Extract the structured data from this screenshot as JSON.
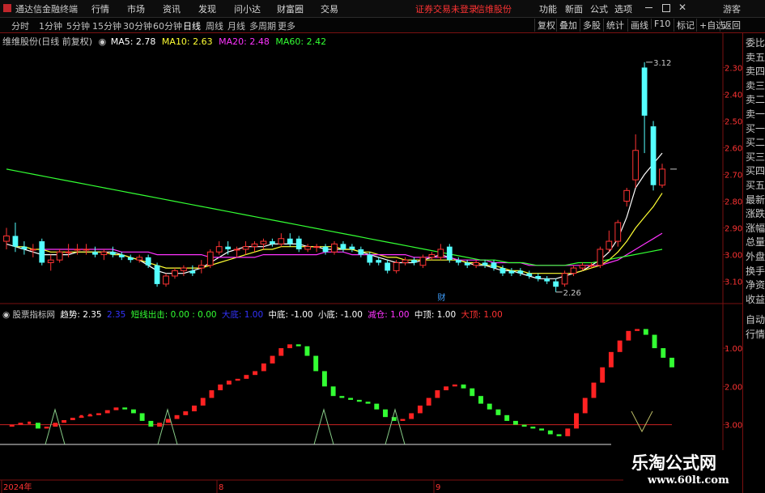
{
  "menubar": {
    "app_title": "通达信金融终端",
    "menus": [
      "行情",
      "市场",
      "资讯",
      "发现",
      "问小达",
      "财富圈",
      "交易"
    ],
    "login_notice": "证券交易未登录",
    "broker": "信维股份",
    "right_items": [
      "功能",
      "新面",
      "公式",
      "选项"
    ],
    "window_controls": [
      "minimize",
      "restore",
      "close"
    ],
    "extra": "游客"
  },
  "period_bar": {
    "periods": [
      "分时",
      "1分钟",
      "5分钟",
      "15分钟",
      "30分钟",
      "60分钟",
      "日线",
      "周线",
      "月线",
      "多周期",
      "更多"
    ],
    "active_period": "日线",
    "tools": [
      "复权",
      "叠加",
      "多股",
      "统计",
      "画线",
      "F10",
      "标记",
      "+自选",
      "返回"
    ]
  },
  "main_chart": {
    "stock_label": "维维股份(日线 前复权)",
    "ma_items": [
      {
        "label": "MA5: 2.78",
        "color": "#ffffff"
      },
      {
        "label": "MA10: 2.63",
        "color": "#ffff33"
      },
      {
        "label": "MA20: 2.48",
        "color": "#ff33ff"
      },
      {
        "label": "MA60: 2.42",
        "color": "#33ff33"
      }
    ],
    "high_marker": "3.12",
    "low_marker": "2.26",
    "cai_marker": "财",
    "y_ticks": [
      "3.10",
      "3.00",
      "2.90",
      "2.80",
      "2.70",
      "2.60",
      "2.50",
      "2.40",
      "2.30"
    ]
  },
  "indicator": {
    "name": "股票指标网",
    "items": [
      {
        "label": "趋势: 2.35",
        "color": "#ffffff"
      },
      {
        "label": "2.35",
        "color": "#3333ff"
      },
      {
        "label": "短线出击: 0.00 : 0.00",
        "color": "#33ff33"
      },
      {
        "label": "大底: 1.00",
        "color": "#3333ff"
      },
      {
        "label": "中底: -1.00",
        "color": "#ffffff"
      },
      {
        "label": "小底: -1.00",
        "color": "#ffffff"
      },
      {
        "label": "减仓: 1.00",
        "color": "#ff33ff"
      },
      {
        "label": "中顶: 1.00",
        "color": "#ffffff"
      },
      {
        "label": "大顶: 1.00",
        "color": "#ff3333"
      }
    ],
    "y_ticks": [
      "3.00",
      "2.00",
      "1.00"
    ]
  },
  "time_axis": [
    "2024年",
    "8",
    "9"
  ],
  "right_panel": {
    "items": [
      "委比",
      "卖五",
      "卖四",
      "卖三",
      "卖二",
      "卖一",
      "买一",
      "买二",
      "买三",
      "买四",
      "买五",
      "最新",
      "涨跌",
      "涨幅",
      "总量",
      "外盘",
      "换手",
      "净资",
      "收益"
    ],
    "bottom_items": [
      "自动",
      "行情"
    ]
  },
  "watermark": {
    "title": "乐淘公式网",
    "url": "www.60lt.com"
  },
  "colors": {
    "up": "#ff3333",
    "down": "#54ffff",
    "grid_red": "#7a1010",
    "ma5": "#ffffff",
    "ma10": "#ffff33",
    "ma20": "#ff33ff",
    "ma60": "#33ff33"
  },
  "chart_data": [
    {
      "type": "candlestick",
      "title": "维维股份(日线 前复权)",
      "ylim": [
        2.22,
        3.18
      ],
      "y_ticks": [
        2.3,
        2.4,
        2.5,
        2.6,
        2.7,
        2.8,
        2.9,
        3.0,
        3.1
      ],
      "candles": [
        {
          "o": 2.45,
          "h": 2.5,
          "l": 2.42,
          "c": 2.47
        },
        {
          "o": 2.47,
          "h": 2.52,
          "l": 2.41,
          "c": 2.43
        },
        {
          "o": 2.43,
          "h": 2.45,
          "l": 2.4,
          "c": 2.42
        },
        {
          "o": 2.42,
          "h": 2.44,
          "l": 2.39,
          "c": 2.42
        },
        {
          "o": 2.45,
          "h": 2.46,
          "l": 2.36,
          "c": 2.37
        },
        {
          "o": 2.37,
          "h": 2.4,
          "l": 2.34,
          "c": 2.38
        },
        {
          "o": 2.38,
          "h": 2.42,
          "l": 2.37,
          "c": 2.41
        },
        {
          "o": 2.41,
          "h": 2.44,
          "l": 2.39,
          "c": 2.41
        },
        {
          "o": 2.42,
          "h": 2.44,
          "l": 2.4,
          "c": 2.42
        },
        {
          "o": 2.42,
          "h": 2.44,
          "l": 2.4,
          "c": 2.42
        },
        {
          "o": 2.41,
          "h": 2.43,
          "l": 2.39,
          "c": 2.4
        },
        {
          "o": 2.4,
          "h": 2.42,
          "l": 2.38,
          "c": 2.41
        },
        {
          "o": 2.41,
          "h": 2.43,
          "l": 2.39,
          "c": 2.4
        },
        {
          "o": 2.4,
          "h": 2.41,
          "l": 2.38,
          "c": 2.39
        },
        {
          "o": 2.39,
          "h": 2.4,
          "l": 2.37,
          "c": 2.38
        },
        {
          "o": 2.38,
          "h": 2.4,
          "l": 2.37,
          "c": 2.39
        },
        {
          "o": 2.39,
          "h": 2.4,
          "l": 2.35,
          "c": 2.36
        },
        {
          "o": 2.36,
          "h": 2.37,
          "l": 2.28,
          "c": 2.29
        },
        {
          "o": 2.29,
          "h": 2.33,
          "l": 2.28,
          "c": 2.32
        },
        {
          "o": 2.32,
          "h": 2.35,
          "l": 2.31,
          "c": 2.34
        },
        {
          "o": 2.34,
          "h": 2.36,
          "l": 2.32,
          "c": 2.35
        },
        {
          "o": 2.34,
          "h": 2.36,
          "l": 2.32,
          "c": 2.33
        },
        {
          "o": 2.35,
          "h": 2.38,
          "l": 2.33,
          "c": 2.36
        },
        {
          "o": 2.36,
          "h": 2.42,
          "l": 2.35,
          "c": 2.41
        },
        {
          "o": 2.41,
          "h": 2.45,
          "l": 2.4,
          "c": 2.43
        },
        {
          "o": 2.43,
          "h": 2.45,
          "l": 2.4,
          "c": 2.42
        },
        {
          "o": 2.42,
          "h": 2.43,
          "l": 2.39,
          "c": 2.42
        },
        {
          "o": 2.42,
          "h": 2.45,
          "l": 2.4,
          "c": 2.43
        },
        {
          "o": 2.43,
          "h": 2.45,
          "l": 2.41,
          "c": 2.44
        },
        {
          "o": 2.44,
          "h": 2.46,
          "l": 2.42,
          "c": 2.45
        },
        {
          "o": 2.45,
          "h": 2.46,
          "l": 2.43,
          "c": 2.44
        },
        {
          "o": 2.44,
          "h": 2.48,
          "l": 2.43,
          "c": 2.46
        },
        {
          "o": 2.46,
          "h": 2.48,
          "l": 2.43,
          "c": 2.44
        },
        {
          "o": 2.46,
          "h": 2.47,
          "l": 2.41,
          "c": 2.42
        },
        {
          "o": 2.42,
          "h": 2.44,
          "l": 2.41,
          "c": 2.43
        },
        {
          "o": 2.43,
          "h": 2.44,
          "l": 2.41,
          "c": 2.43
        },
        {
          "o": 2.43,
          "h": 2.44,
          "l": 2.4,
          "c": 2.41
        },
        {
          "o": 2.41,
          "h": 2.45,
          "l": 2.4,
          "c": 2.44
        },
        {
          "o": 2.44,
          "h": 2.45,
          "l": 2.41,
          "c": 2.42
        },
        {
          "o": 2.43,
          "h": 2.44,
          "l": 2.41,
          "c": 2.42
        },
        {
          "o": 2.42,
          "h": 2.43,
          "l": 2.39,
          "c": 2.4
        },
        {
          "o": 2.4,
          "h": 2.41,
          "l": 2.36,
          "c": 2.37
        },
        {
          "o": 2.38,
          "h": 2.39,
          "l": 2.36,
          "c": 2.37
        },
        {
          "o": 2.37,
          "h": 2.38,
          "l": 2.33,
          "c": 2.34
        },
        {
          "o": 2.34,
          "h": 2.38,
          "l": 2.33,
          "c": 2.37
        },
        {
          "o": 2.37,
          "h": 2.39,
          "l": 2.36,
          "c": 2.38
        },
        {
          "o": 2.38,
          "h": 2.39,
          "l": 2.36,
          "c": 2.37
        },
        {
          "o": 2.36,
          "h": 2.4,
          "l": 2.35,
          "c": 2.39
        },
        {
          "o": 2.39,
          "h": 2.41,
          "l": 2.38,
          "c": 2.4
        },
        {
          "o": 2.39,
          "h": 2.44,
          "l": 2.38,
          "c": 2.42
        },
        {
          "o": 2.43,
          "h": 2.44,
          "l": 2.37,
          "c": 2.38
        },
        {
          "o": 2.38,
          "h": 2.39,
          "l": 2.36,
          "c": 2.37
        },
        {
          "o": 2.37,
          "h": 2.38,
          "l": 2.35,
          "c": 2.36
        },
        {
          "o": 2.36,
          "h": 2.38,
          "l": 2.35,
          "c": 2.37
        },
        {
          "o": 2.37,
          "h": 2.38,
          "l": 2.35,
          "c": 2.36
        },
        {
          "o": 2.37,
          "h": 2.38,
          "l": 2.34,
          "c": 2.35
        },
        {
          "o": 2.35,
          "h": 2.36,
          "l": 2.32,
          "c": 2.33
        },
        {
          "o": 2.34,
          "h": 2.35,
          "l": 2.32,
          "c": 2.33
        },
        {
          "o": 2.34,
          "h": 2.35,
          "l": 2.32,
          "c": 2.33
        },
        {
          "o": 2.33,
          "h": 2.34,
          "l": 2.31,
          "c": 2.32
        },
        {
          "o": 2.32,
          "h": 2.33,
          "l": 2.3,
          "c": 2.31
        },
        {
          "o": 2.31,
          "h": 2.32,
          "l": 2.29,
          "c": 2.3
        },
        {
          "o": 2.3,
          "h": 2.31,
          "l": 2.26,
          "c": 2.28
        },
        {
          "o": 2.29,
          "h": 2.34,
          "l": 2.28,
          "c": 2.33
        },
        {
          "o": 2.33,
          "h": 2.36,
          "l": 2.32,
          "c": 2.35
        },
        {
          "o": 2.35,
          "h": 2.37,
          "l": 2.34,
          "c": 2.36
        },
        {
          "o": 2.36,
          "h": 2.37,
          "l": 2.35,
          "c": 2.36
        },
        {
          "o": 2.36,
          "h": 2.43,
          "l": 2.35,
          "c": 2.42
        },
        {
          "o": 2.42,
          "h": 2.49,
          "l": 2.41,
          "c": 2.45
        },
        {
          "o": 2.45,
          "h": 2.53,
          "l": 2.43,
          "c": 2.52
        },
        {
          "o": 2.6,
          "h": 2.65,
          "l": 2.58,
          "c": 2.64
        },
        {
          "o": 2.68,
          "h": 2.85,
          "l": 2.65,
          "c": 2.79
        },
        {
          "o": 3.1,
          "h": 3.12,
          "l": 2.78,
          "c": 2.92
        },
        {
          "o": 2.88,
          "h": 2.9,
          "l": 2.64,
          "c": 2.66
        },
        {
          "o": 2.66,
          "h": 2.74,
          "l": 2.65,
          "c": 2.72
        }
      ],
      "ma_series": [
        {
          "name": "MA5",
          "values": [
            2.44,
            2.43,
            2.42,
            2.41,
            2.4,
            2.4,
            2.4,
            2.4,
            2.41,
            2.41,
            2.41,
            2.41,
            2.41,
            2.4,
            2.39,
            2.38,
            2.36,
            2.34,
            2.33,
            2.33,
            2.33,
            2.34,
            2.35,
            2.37,
            2.39,
            2.41,
            2.42,
            2.43,
            2.43,
            2.43,
            2.44,
            2.44,
            2.44,
            2.44,
            2.43,
            2.43,
            2.42,
            2.42,
            2.42,
            2.42,
            2.41,
            2.4,
            2.39,
            2.38,
            2.37,
            2.37,
            2.37,
            2.38,
            2.39,
            2.4,
            2.39,
            2.38,
            2.37,
            2.36,
            2.36,
            2.35,
            2.34,
            2.34,
            2.33,
            2.32,
            2.31,
            2.31,
            2.31,
            2.32,
            2.33,
            2.34,
            2.36,
            2.38,
            2.41,
            2.46,
            2.54,
            2.65,
            2.7,
            2.74,
            2.78
          ]
        },
        {
          "name": "MA10",
          "values": [
            2.43,
            2.43,
            2.42,
            2.42,
            2.41,
            2.41,
            2.41,
            2.41,
            2.41,
            2.41,
            2.41,
            2.4,
            2.4,
            2.39,
            2.38,
            2.37,
            2.36,
            2.35,
            2.35,
            2.35,
            2.35,
            2.35,
            2.36,
            2.37,
            2.38,
            2.39,
            2.4,
            2.41,
            2.42,
            2.42,
            2.43,
            2.43,
            2.43,
            2.43,
            2.43,
            2.43,
            2.43,
            2.42,
            2.42,
            2.41,
            2.41,
            2.4,
            2.39,
            2.39,
            2.38,
            2.38,
            2.38,
            2.38,
            2.38,
            2.38,
            2.38,
            2.37,
            2.37,
            2.36,
            2.36,
            2.35,
            2.34,
            2.34,
            2.33,
            2.33,
            2.33,
            2.33,
            2.33,
            2.33,
            2.34,
            2.35,
            2.36,
            2.38,
            2.41,
            2.45,
            2.5,
            2.54,
            2.58,
            2.63
          ]
        },
        {
          "name": "MA20",
          "values": [
            2.42,
            2.42,
            2.42,
            2.42,
            2.42,
            2.42,
            2.42,
            2.42,
            2.42,
            2.41,
            2.41,
            2.41,
            2.41,
            2.4,
            2.4,
            2.4,
            2.4,
            2.4,
            2.4,
            2.39,
            2.39,
            2.39,
            2.39,
            2.39,
            2.39,
            2.4,
            2.4,
            2.4,
            2.4,
            2.4,
            2.4,
            2.4,
            2.41,
            2.41,
            2.41,
            2.4,
            2.4,
            2.4,
            2.4,
            2.4,
            2.4,
            2.4,
            2.39,
            2.39,
            2.39,
            2.39,
            2.39,
            2.38,
            2.38,
            2.38,
            2.38,
            2.37,
            2.37,
            2.37,
            2.37,
            2.36,
            2.36,
            2.36,
            2.36,
            2.36,
            2.36,
            2.36,
            2.36,
            2.36,
            2.37,
            2.38,
            2.4,
            2.42,
            2.44,
            2.46,
            2.48
          ]
        },
        {
          "name": "MA60",
          "values": [
            2.72,
            2.71,
            2.7,
            2.69,
            2.68,
            2.67,
            2.66,
            2.65,
            2.64,
            2.63,
            2.62,
            2.61,
            2.6,
            2.59,
            2.58,
            2.57,
            2.56,
            2.55,
            2.54,
            2.53,
            2.52,
            2.51,
            2.5,
            2.49,
            2.48,
            2.47,
            2.46,
            2.45,
            2.44,
            2.43,
            2.42,
            2.41,
            2.4,
            2.39,
            2.38,
            2.38,
            2.37,
            2.37,
            2.36,
            2.36,
            2.36,
            2.37,
            2.37,
            2.38,
            2.39,
            2.4,
            2.41,
            2.42
          ]
        }
      ]
    },
    {
      "type": "bar",
      "title": "股票指标网",
      "ylim": [
        0.4,
        3.7
      ],
      "y_ticks": [
        1.0,
        2.0,
        3.0
      ],
      "trend_values": [
        0.95,
        1.0,
        1.05,
        1.05,
        0.9,
        0.95,
        1.05,
        1.12,
        1.18,
        1.22,
        1.25,
        1.3,
        1.38,
        1.45,
        1.4,
        1.3,
        1.1,
        0.95,
        1.05,
        1.15,
        1.25,
        1.35,
        1.5,
        1.7,
        1.9,
        2.05,
        2.15,
        2.2,
        2.3,
        2.4,
        2.6,
        2.8,
        3.0,
        3.1,
        3.05,
        2.8,
        2.4,
        2.0,
        1.75,
        1.7,
        1.65,
        1.6,
        1.55,
        1.4,
        1.2,
        1.1,
        1.15,
        1.3,
        1.5,
        1.7,
        1.9,
        2.0,
        2.05,
        1.95,
        1.75,
        1.55,
        1.4,
        1.25,
        1.1,
        1.0,
        0.95,
        0.9,
        0.85,
        0.75,
        0.7,
        0.9,
        1.3,
        1.7,
        2.1,
        2.5,
        2.9,
        3.2,
        3.45,
        3.5,
        3.35,
        3.0,
        2.75,
        2.5
      ],
      "reference_line": 1.0,
      "triangle_signals": [
        16,
        56,
        118,
        121
      ]
    }
  ]
}
